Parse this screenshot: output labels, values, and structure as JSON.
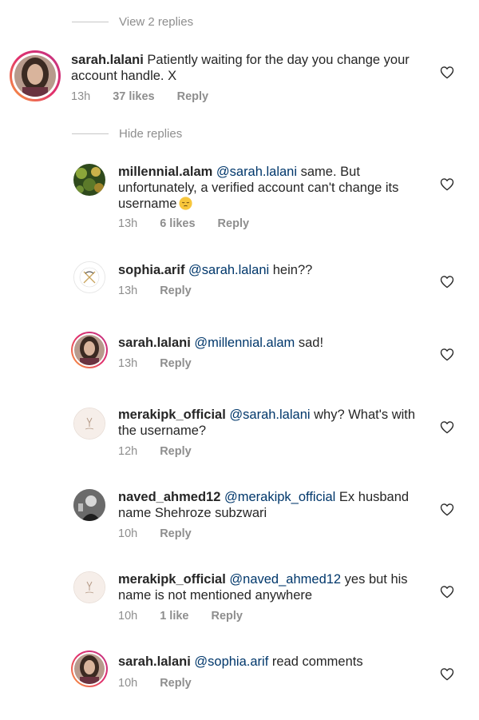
{
  "toggles": {
    "view_replies": "View 2 replies",
    "hide_replies": "Hide replies"
  },
  "main_comment": {
    "username": "sarah.lalani",
    "text_line1": "Patiently waiting for the day you change your",
    "text_line2": "account handle. X",
    "time": "13h",
    "likes": "37 likes",
    "reply": "Reply"
  },
  "replies": [
    {
      "username": "millennial.alam",
      "mention": "@sarah.lalani",
      "text_line1": " same. But",
      "text_line2": "unfortunately, a verified account can't change its",
      "text_line3": "username",
      "emoji": "pensive-face-emoji",
      "time": "13h",
      "likes": "6 likes",
      "reply": "Reply"
    },
    {
      "username": "sophia.arif",
      "mention": "@sarah.lalani",
      "text": " hein??",
      "time": "13h",
      "reply": "Reply"
    },
    {
      "username": "sarah.lalani",
      "mention": "@millennial.alam",
      "text": " sad!",
      "time": "13h",
      "reply": "Reply"
    },
    {
      "username": "merakipk_official",
      "mention": "@sarah.lalani",
      "text_line1": " why? What's with",
      "text_line2": "the username?",
      "time": "12h",
      "reply": "Reply"
    },
    {
      "username": "naved_ahmed12",
      "mention": "@merakipk_official",
      "text_line1": " Ex husband",
      "text_line2": "name Shehroze subzwari",
      "time": "10h",
      "reply": "Reply"
    },
    {
      "username": "merakipk_official",
      "mention": "@naved_ahmed12",
      "text_line1": " yes but his",
      "text_line2": "name is not mentioned anywhere",
      "time": "10h",
      "likes": "1 like",
      "reply": "Reply"
    },
    {
      "username": "sarah.lalani",
      "mention": "@sophia.arif",
      "text": " read comments",
      "time": "10h",
      "reply": "Reply"
    }
  ],
  "colors": {
    "text": "#262626",
    "secondary": "#8e8e8e",
    "mention": "#00376b",
    "story_ring_start": "#f9a23b",
    "story_ring_end": "#c13584"
  }
}
